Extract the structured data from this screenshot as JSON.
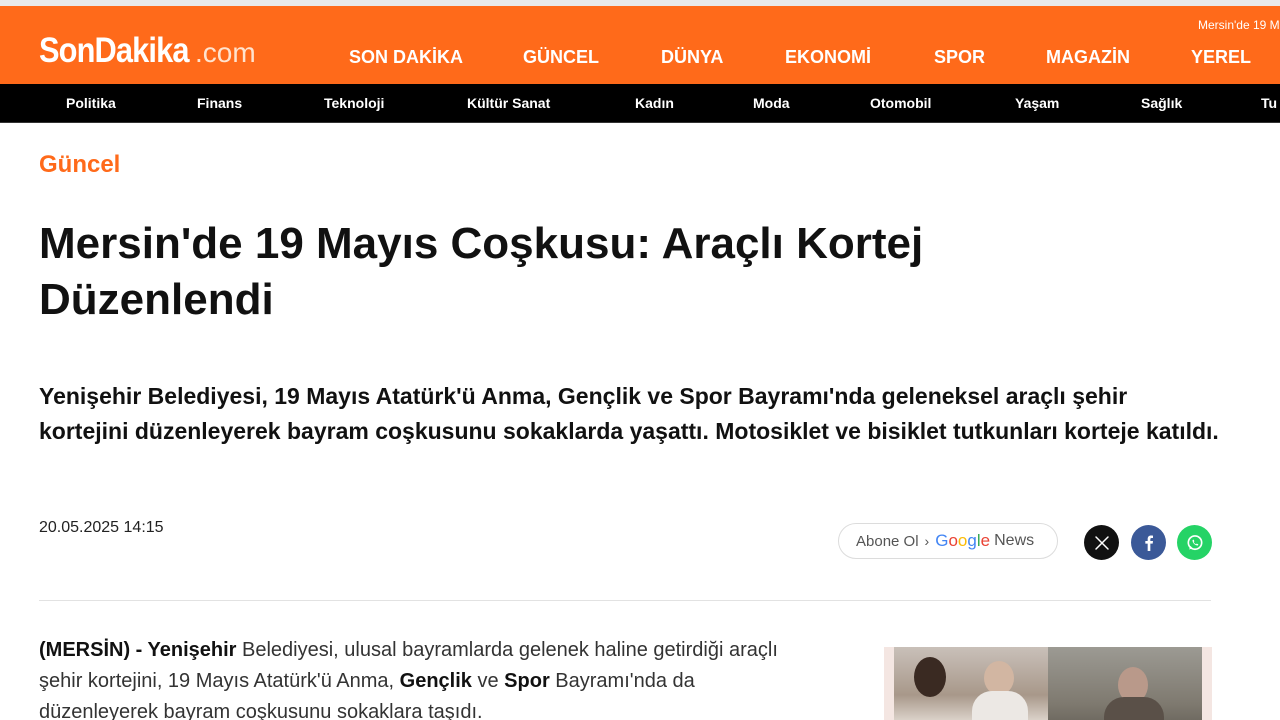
{
  "header": {
    "logo_main": "SonDakika",
    "logo_tld": ".com",
    "ticker": "Mersin'de 19 M",
    "main_nav": [
      "SON DAKİKA",
      "GÜNCEL",
      "DÜNYA",
      "EKONOMİ",
      "SPOR",
      "MAGAZİN",
      "YEREL"
    ],
    "sub_nav": [
      "Politika",
      "Finans",
      "Teknoloji",
      "Kültür Sanat",
      "Kadın",
      "Moda",
      "Otomobil",
      "Yaşam",
      "Sağlık",
      "Tu"
    ]
  },
  "article": {
    "category": "Güncel",
    "headline": "Mersin'de 19 Mayıs Coşkusu: Araçlı Kortej Düzenlendi",
    "summary": "Yenişehir Belediyesi, 19 Mayıs Atatürk'ü Anma, Gençlik ve Spor Bayramı'nda geleneksel araçlı şehir kortejini düzenleyerek bayram coşkusunu sokaklarda yaşattı. Motosiklet ve bisiklet tutkunları korteje katıldı.",
    "date": "20.05.2025 14:15",
    "body": {
      "b1": "(MERSİN) - Yenişehir",
      "t1": " Belediyesi, ulusal bayramlarda gelenek haline getirdiği araçlı şehir kortejini, 19 Mayıs Atatürk'ü Anma, ",
      "b2": "Gençlik",
      "t2": " ve ",
      "b3": "Spor",
      "t3": " Bayramı'nda da düzenleyerek bayram coşkusunu sokaklara taşıdı."
    }
  },
  "google_news": {
    "abone": "Abone Ol",
    "chevron": "›",
    "google_letters": [
      "G",
      "o",
      "o",
      "g",
      "l",
      "e"
    ],
    "news": "News"
  },
  "social": [
    {
      "name": "x",
      "color": "#111111"
    },
    {
      "name": "facebook",
      "color": "#3b5998"
    },
    {
      "name": "whatsapp",
      "color": "#25d366"
    }
  ],
  "colors": {
    "brand_orange": "#ff6a1a",
    "nav_black": "#000000"
  }
}
